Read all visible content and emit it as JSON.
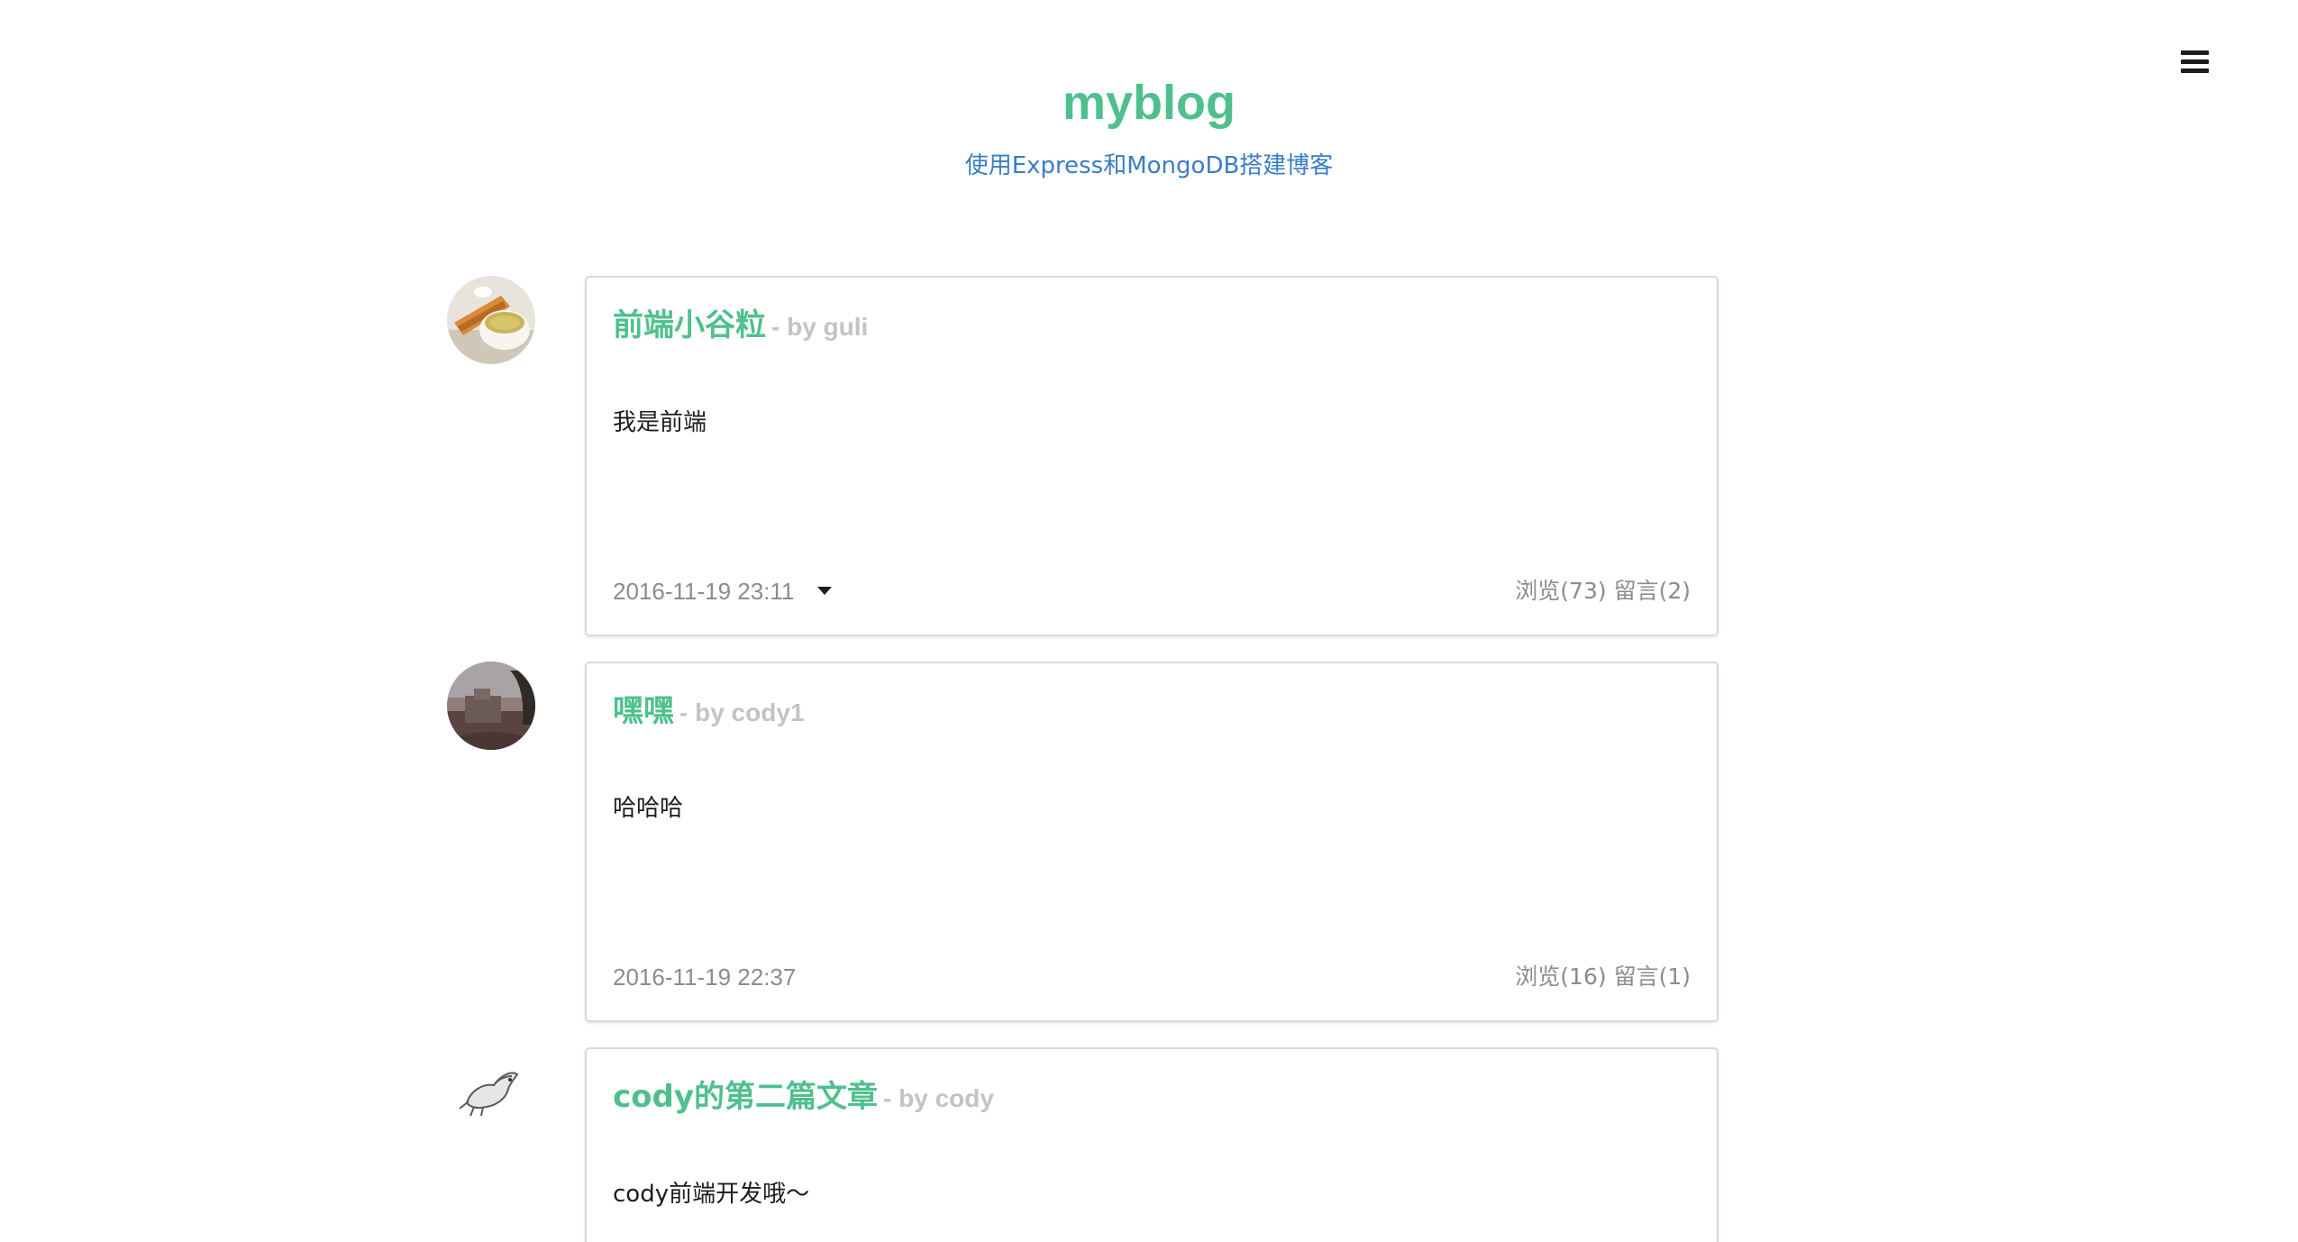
{
  "site": {
    "title": "myblog",
    "description": "使用Express和MongoDB搭建博客"
  },
  "menu": {
    "icon": "hamburger-menu-icon"
  },
  "posts": [
    {
      "title": "前端小谷粒",
      "by": "- by guli",
      "content": "我是前端",
      "date": "2016-11-19 23:11",
      "views": "浏览(73)",
      "comments": "留言(2)",
      "has_dropdown": true,
      "avatar": "tea-cup-avatar"
    },
    {
      "title": "嘿嘿",
      "by": "- by cody1",
      "content": "哈哈哈",
      "date": "2016-11-19 22:37",
      "views": "浏览(16)",
      "comments": "留言(1)",
      "has_dropdown": false,
      "avatar": "landscape-avatar"
    },
    {
      "title": "cody的第二篇文章",
      "by": "- by cody",
      "content": "cody前端开发哦～",
      "avatar": "bird-avatar"
    }
  ],
  "colors": {
    "accent": "#4fc08d",
    "link": "#3a7cc6",
    "muted": "#8c8c8c",
    "author": "#c3c3c3"
  }
}
